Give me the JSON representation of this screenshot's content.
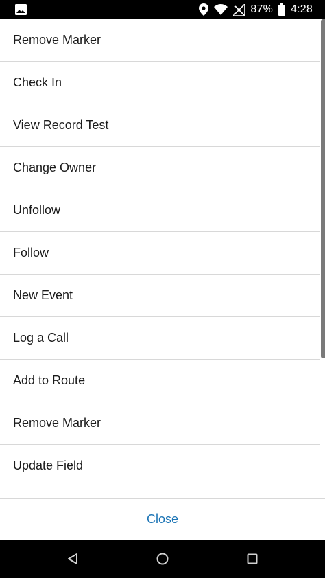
{
  "status_bar": {
    "battery_percent": "87%",
    "time": "4:28",
    "icons": [
      "image-icon",
      "location-icon",
      "wifi-icon",
      "signal-off-icon",
      "battery-icon"
    ]
  },
  "actions": [
    {
      "label": "Remove Marker"
    },
    {
      "label": "Check In"
    },
    {
      "label": "View Record Test"
    },
    {
      "label": "Change Owner"
    },
    {
      "label": "Unfollow"
    },
    {
      "label": "Follow"
    },
    {
      "label": "New Event"
    },
    {
      "label": "Log a Call"
    },
    {
      "label": "Add to Route"
    },
    {
      "label": "Remove Marker"
    },
    {
      "label": "Update Field"
    },
    {
      "label": ""
    }
  ],
  "close_button": {
    "label": "Close",
    "color": "#1b74b5"
  },
  "nav_bar": {
    "icons": [
      "back-icon",
      "home-icon",
      "recents-icon"
    ]
  }
}
